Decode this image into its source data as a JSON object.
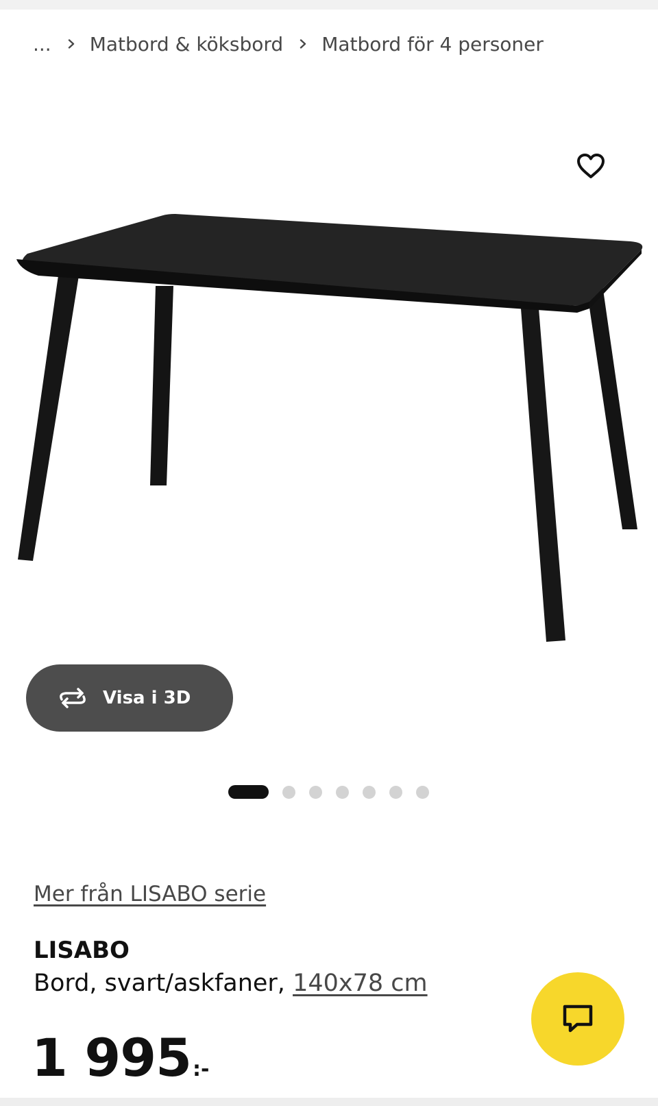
{
  "breadcrumb": {
    "items": [
      {
        "label": "..."
      },
      {
        "label": "Matbord & köksbord"
      },
      {
        "label": "Matbord för 4 personer"
      }
    ]
  },
  "gallery": {
    "view_3d_label": "Visa i 3D",
    "image_count": 7,
    "active_index": 0
  },
  "product": {
    "series_link": "Mer från LISABO serie",
    "name": "LISABO",
    "description": "Bord, svart/askfaner,",
    "size": "140x78 cm",
    "price": "1 995",
    "price_suffix": ":-"
  },
  "icons": {
    "favorite": "heart-icon",
    "view_3d": "rotate-3d-icon",
    "chat": "chat-icon",
    "breadcrumb_separator": "chevron-right-icon"
  },
  "colors": {
    "chat_button": "#f7d72b",
    "view_3d_button": "#4d4d4d",
    "active_dot": "#111111",
    "inactive_dot": "#d3d3d3"
  }
}
